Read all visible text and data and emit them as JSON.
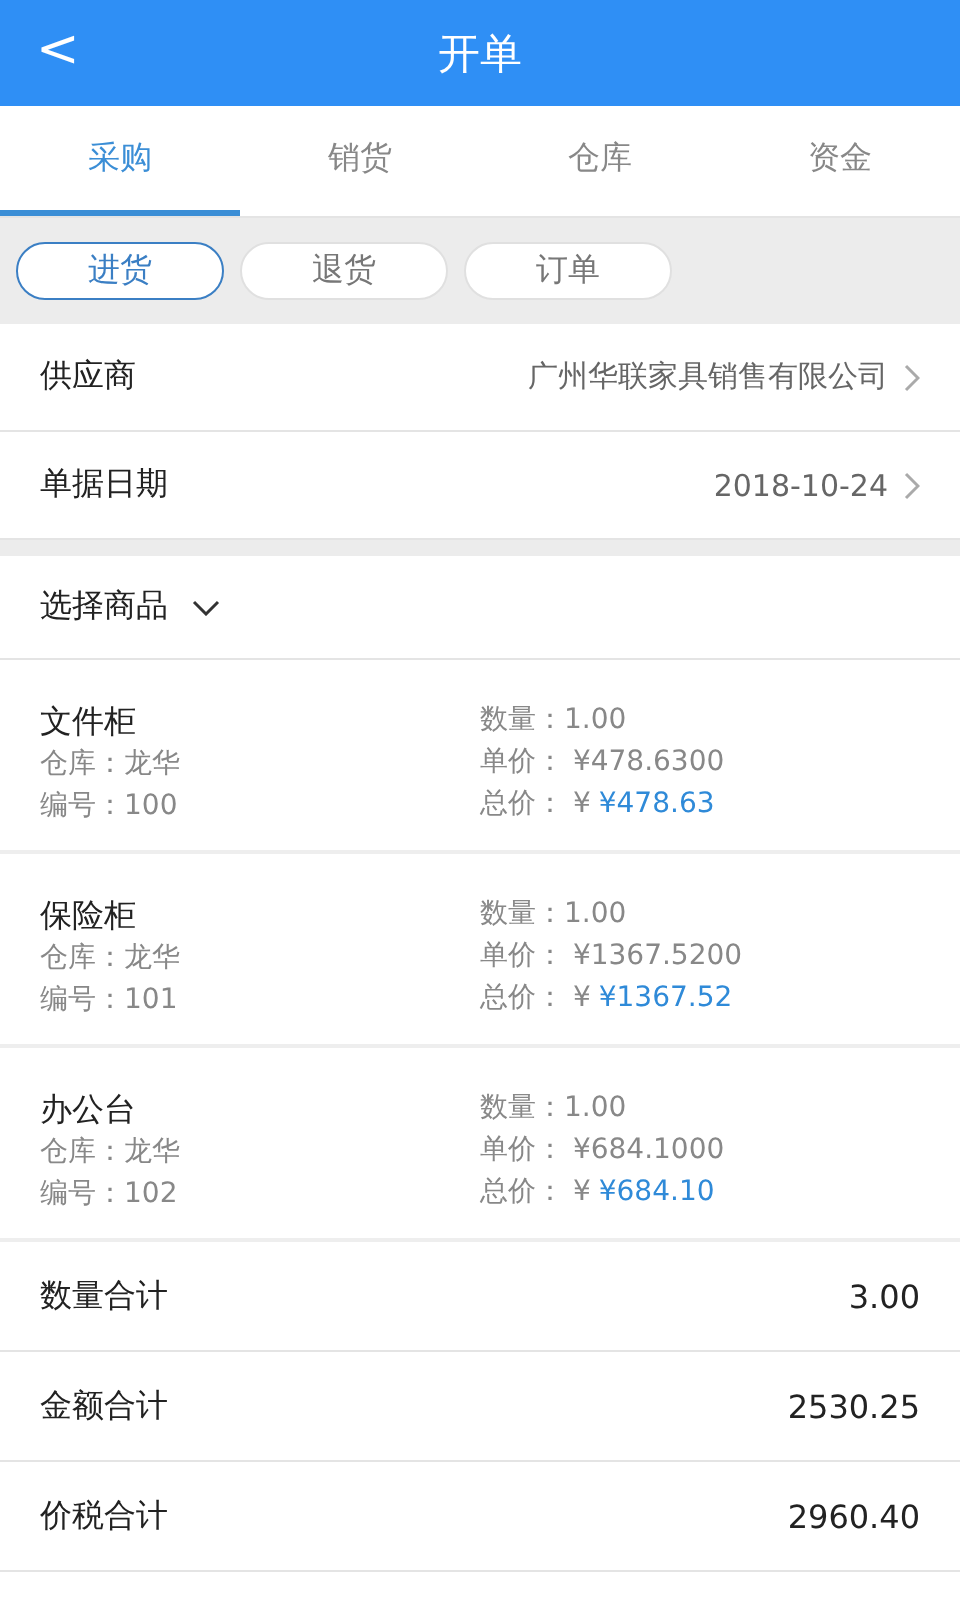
{
  "header": {
    "back": "<",
    "title": "开单"
  },
  "tabs": [
    {
      "label": "采购",
      "selected": true
    },
    {
      "label": "销货",
      "selected": false
    },
    {
      "label": "仓库",
      "selected": false
    },
    {
      "label": "资金",
      "selected": false
    }
  ],
  "sub_tabs": [
    {
      "label": "进货",
      "selected": true
    },
    {
      "label": "退货",
      "selected": false
    },
    {
      "label": "订单",
      "selected": false
    }
  ],
  "fields": [
    {
      "label": "供应商",
      "value": "广州华联家具销售有限公司"
    },
    {
      "label": "单据日期",
      "value": "2018-10-24"
    }
  ],
  "goods_picker": {
    "label": "选择商品"
  },
  "items": [
    {
      "name": "文件柜",
      "warehouse_label": "仓库：",
      "warehouse": "龙华",
      "code_label": "编号：",
      "code": "100",
      "qty_label": "数量：",
      "qty": "1.00",
      "price_label": "单价：",
      "price": "¥478.6300",
      "total_label": "总价：",
      "total_prefix": "¥",
      "total": "¥478.63"
    },
    {
      "name": "保险柜",
      "warehouse_label": "仓库：",
      "warehouse": "龙华",
      "code_label": "编号：",
      "code": "101",
      "qty_label": "数量：",
      "qty": "1.00",
      "price_label": "单价：",
      "price": "¥1367.5200",
      "total_label": "总价：",
      "total_prefix": "¥",
      "total": "¥1367.52"
    },
    {
      "name": "办公台",
      "warehouse_label": "仓库：",
      "warehouse": "龙华",
      "code_label": "编号：",
      "code": "102",
      "qty_label": "数量：",
      "qty": "1.00",
      "price_label": "单价：",
      "price": "¥684.1000",
      "total_label": "总价：",
      "total_prefix": "¥",
      "total": "¥684.10"
    }
  ],
  "totals": [
    {
      "label": "数量合计",
      "value": "3.00"
    },
    {
      "label": "金额合计",
      "value": "2530.25"
    },
    {
      "label": "价税合计",
      "value": "2960.40"
    }
  ]
}
